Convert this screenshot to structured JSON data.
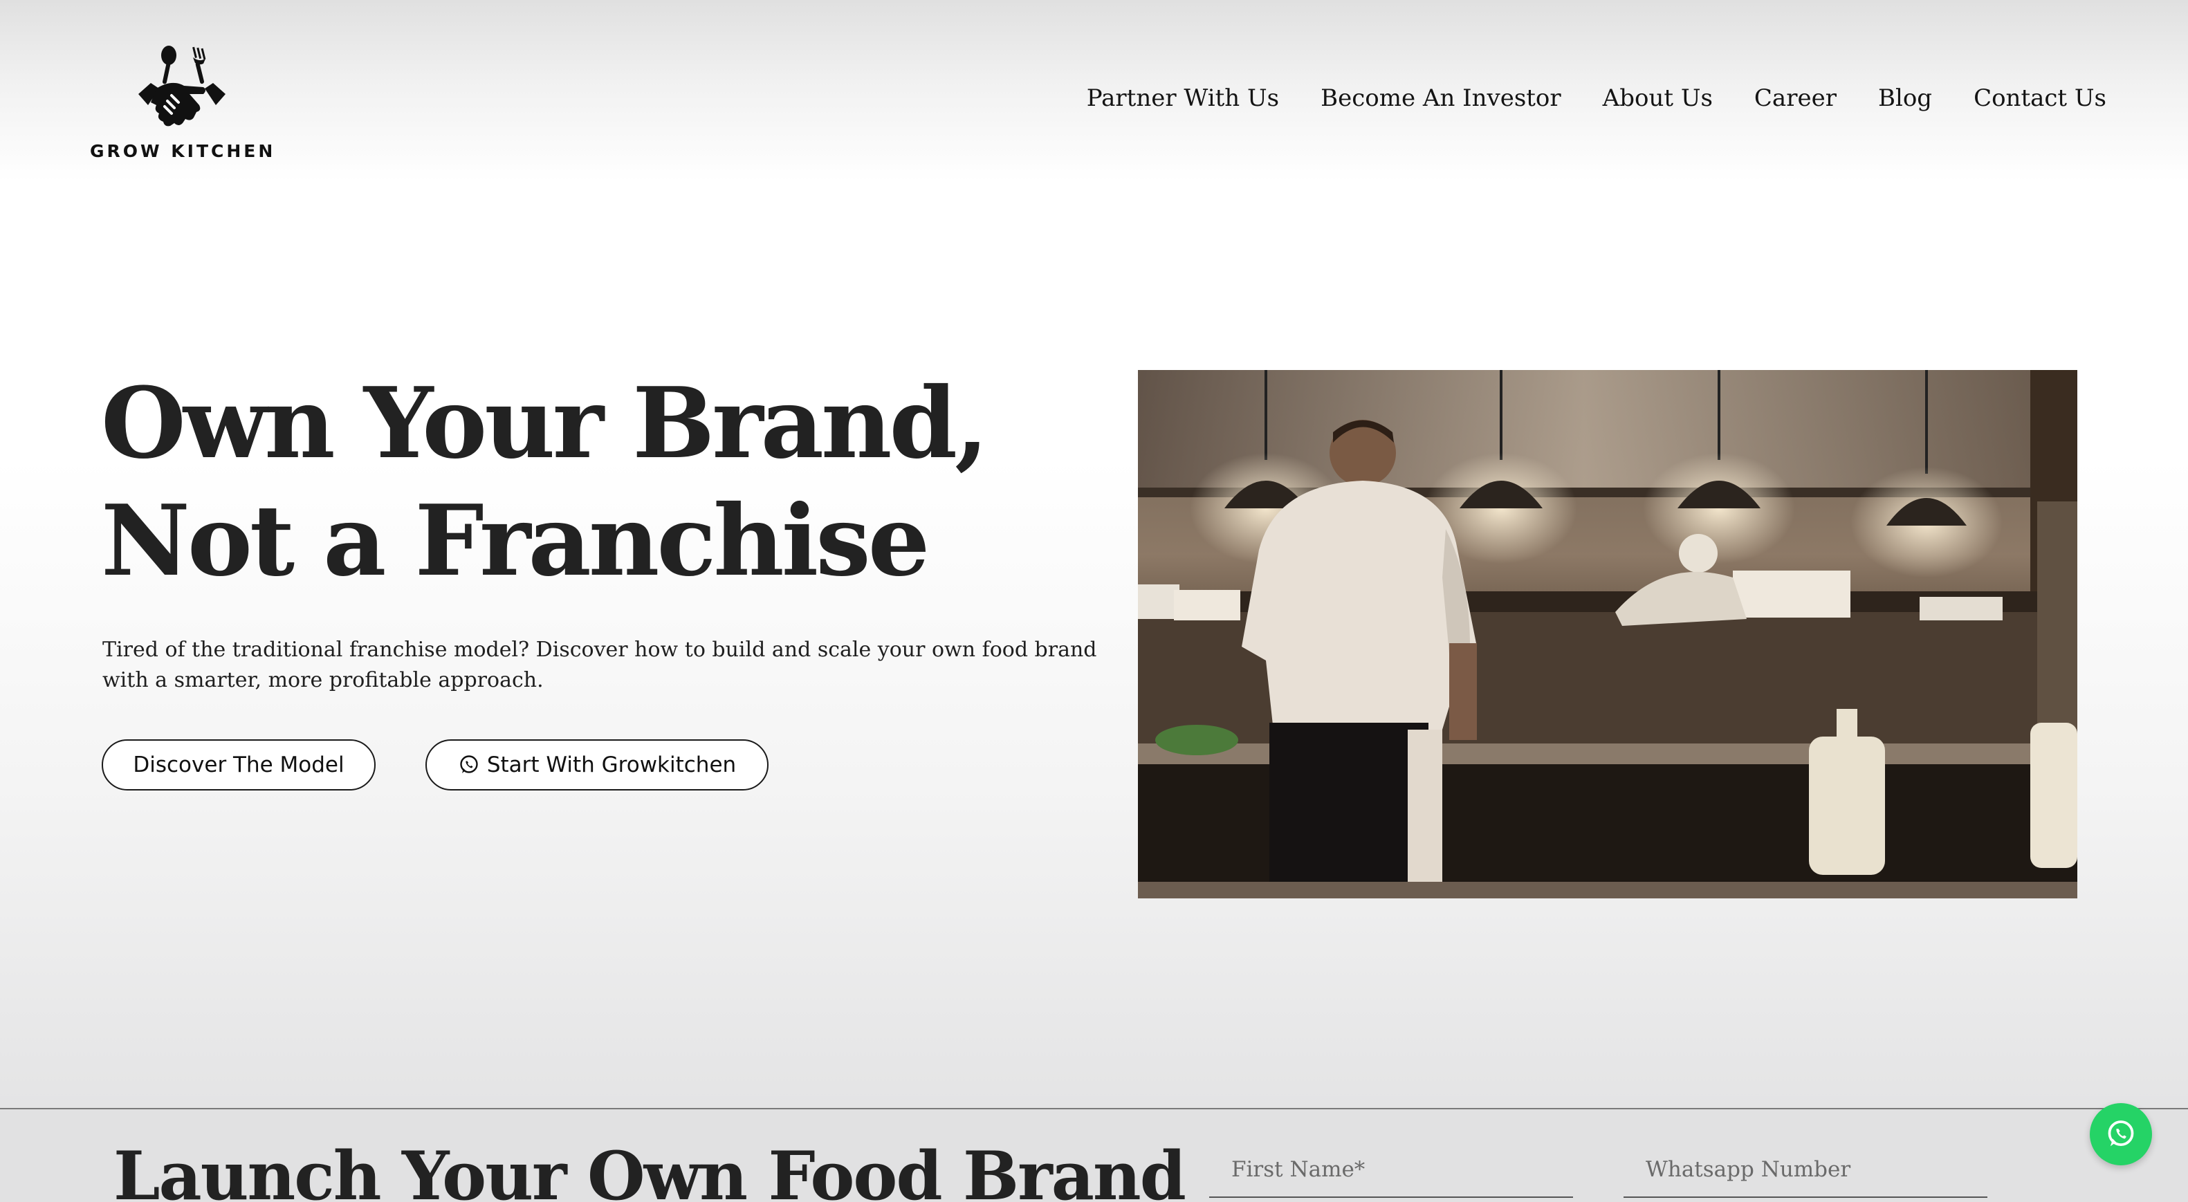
{
  "header": {
    "logo_text": "GROW KITCHEN",
    "logo_icon": "handshake-fork-spoon-icon",
    "nav": [
      {
        "label": "Partner With Us"
      },
      {
        "label": "Become An Investor"
      },
      {
        "label": "About Us"
      },
      {
        "label": "Career"
      },
      {
        "label": "Blog"
      },
      {
        "label": "Contact Us"
      }
    ]
  },
  "hero": {
    "title_line1": "Own Your Brand,",
    "title_line2": "Not a Franchise",
    "description": "Tired of the traditional franchise model? Discover how to build and scale your own food brand with a smarter, more profitable approach.",
    "btn_discover": "Discover The Model",
    "btn_start": "Start With Growkitchen",
    "btn_start_icon": "whatsapp-icon"
  },
  "signup": {
    "title": "Launch Your Own Food Brand",
    "first_name_placeholder": "First Name*",
    "whatsapp_placeholder": "Whatsapp Number"
  },
  "floating": {
    "icon": "whatsapp-icon",
    "color": "#25d366"
  }
}
